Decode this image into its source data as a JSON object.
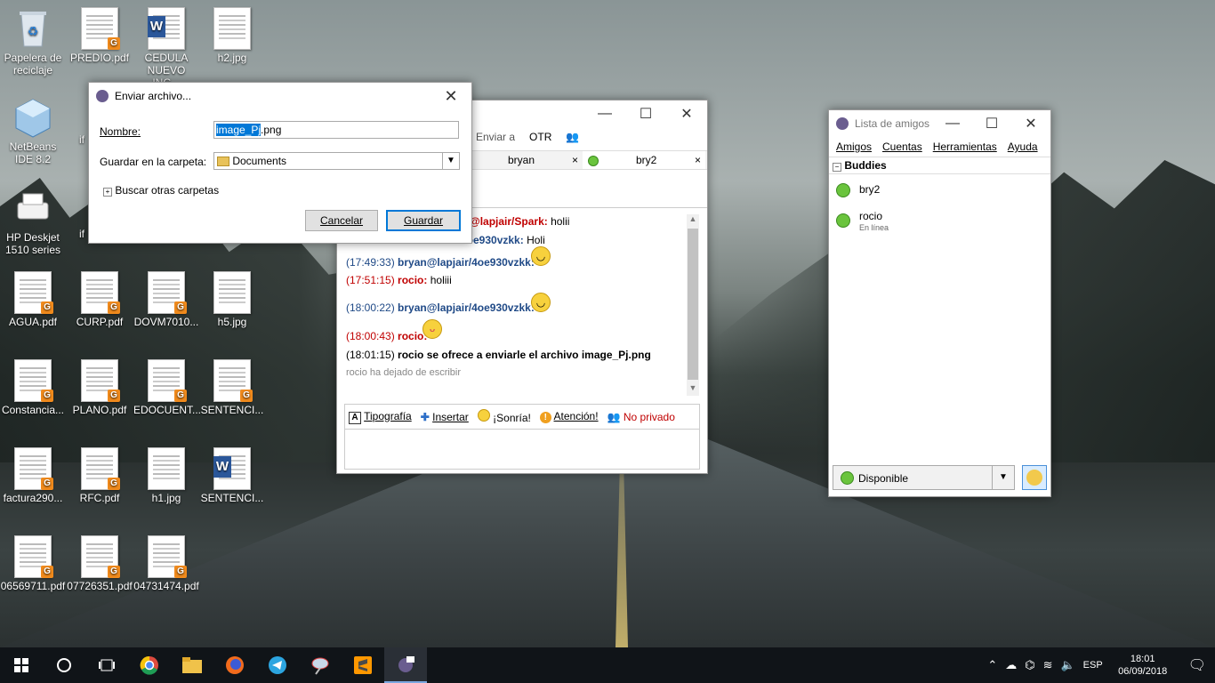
{
  "desktop": {
    "icons": [
      {
        "label": "Papelera de reciclaje",
        "glyph": "recycle-bin"
      },
      {
        "label": "PREDIO.pdf",
        "glyph": "pdf"
      },
      {
        "label": "CEDULA NUEVO ING...",
        "glyph": "word"
      },
      {
        "label": "h2.jpg",
        "glyph": "image"
      },
      {
        "label": "NetBeans IDE 8.2",
        "glyph": "netbeans"
      },
      {
        "label": "if",
        "glyph": "partial"
      },
      {
        "label": "HP Deskjet 1510 series",
        "glyph": "printer"
      },
      {
        "label": "if",
        "glyph": "partial"
      },
      {
        "label": "AGUA.pdf",
        "glyph": "pdf"
      },
      {
        "label": "CURP.pdf",
        "glyph": "pdf"
      },
      {
        "label": "DOVM7010...",
        "glyph": "pdf"
      },
      {
        "label": "h5.jpg",
        "glyph": "image"
      },
      {
        "label": "Constancia...",
        "glyph": "pdf"
      },
      {
        "label": "PLANO.pdf",
        "glyph": "pdf"
      },
      {
        "label": "EDOCUENT...",
        "glyph": "pdf"
      },
      {
        "label": "SENTENCI...",
        "glyph": "pdf"
      },
      {
        "label": "factura290...",
        "glyph": "pdf"
      },
      {
        "label": "RFC.pdf",
        "glyph": "pdf"
      },
      {
        "label": "h1.jpg",
        "glyph": "image"
      },
      {
        "label": "SENTENCI...",
        "glyph": "word"
      },
      {
        "label": "06569711.pdf",
        "glyph": "pdf"
      },
      {
        "label": "07726351.pdf",
        "glyph": "pdf"
      },
      {
        "label": "04731474.pdf",
        "glyph": "pdf"
      }
    ]
  },
  "save_dialog": {
    "title": "Enviar archivo...",
    "name_label": "Nombre:",
    "name_value_selected": "image_Pj",
    "name_value_rest": ".png",
    "folder_label": "Guardar en la carpeta:",
    "folder_value": "Documents",
    "browse_label": "Buscar otras carpetas",
    "cancel_label": "Cancelar",
    "save_label": "Guardar"
  },
  "chat_window": {
    "menu": [
      "Enviar a",
      "OTR"
    ],
    "tabs": [
      {
        "label": "bryan",
        "close": "×"
      },
      {
        "label": "bry2",
        "close": "×"
      }
    ],
    "messages": [
      {
        "time": "",
        "sender": "@lapjair/Spark:",
        "text": "holii",
        "color": "#c00000",
        "emoji": ""
      },
      {
        "time": "",
        "sender": "4oe930vzkk:",
        "text": "Holi",
        "color": "#204a87",
        "emoji": ""
      },
      {
        "time": "(17:49:33)",
        "sender": "bryan@lapjair/4oe930vzkk:",
        "text": "",
        "color": "#204a87",
        "emoji": "smile"
      },
      {
        "time": "(17:51:15)",
        "sender": "rocio:",
        "text": "holiii",
        "color": "#c00000",
        "emoji": ""
      },
      {
        "time": "(18:00:22)",
        "sender": "bryan@lapjair/4oe930vzkk:",
        "text": "",
        "color": "#204a87",
        "emoji": "smile"
      },
      {
        "time": "(18:00:43)",
        "sender": "rocio:",
        "text": "",
        "color": "#c00000",
        "emoji": "tongue"
      }
    ],
    "system_message": {
      "time": "(18:01:15)",
      "text": "rocio se ofrece a enviarle el archivo image_Pj.png"
    },
    "typing_status": "rocio ha dejado de escribir",
    "toolbar": {
      "font": "Tipografía",
      "insert": "Insertar",
      "smile": "¡Sonría!",
      "attention": "Atención!",
      "private": "No privado"
    }
  },
  "buddy_list": {
    "title": "Lista de amigos",
    "menu": [
      "Amigos",
      "Cuentas",
      "Herramientas",
      "Ayuda"
    ],
    "group": "Buddies",
    "buddies": [
      {
        "name": "bry2",
        "status": ""
      },
      {
        "name": "rocio",
        "status": "En línea"
      }
    ],
    "status_value": "Disponible"
  },
  "taskbar": {
    "language": "ESP",
    "time": "18:01",
    "date": "06/09/2018"
  }
}
